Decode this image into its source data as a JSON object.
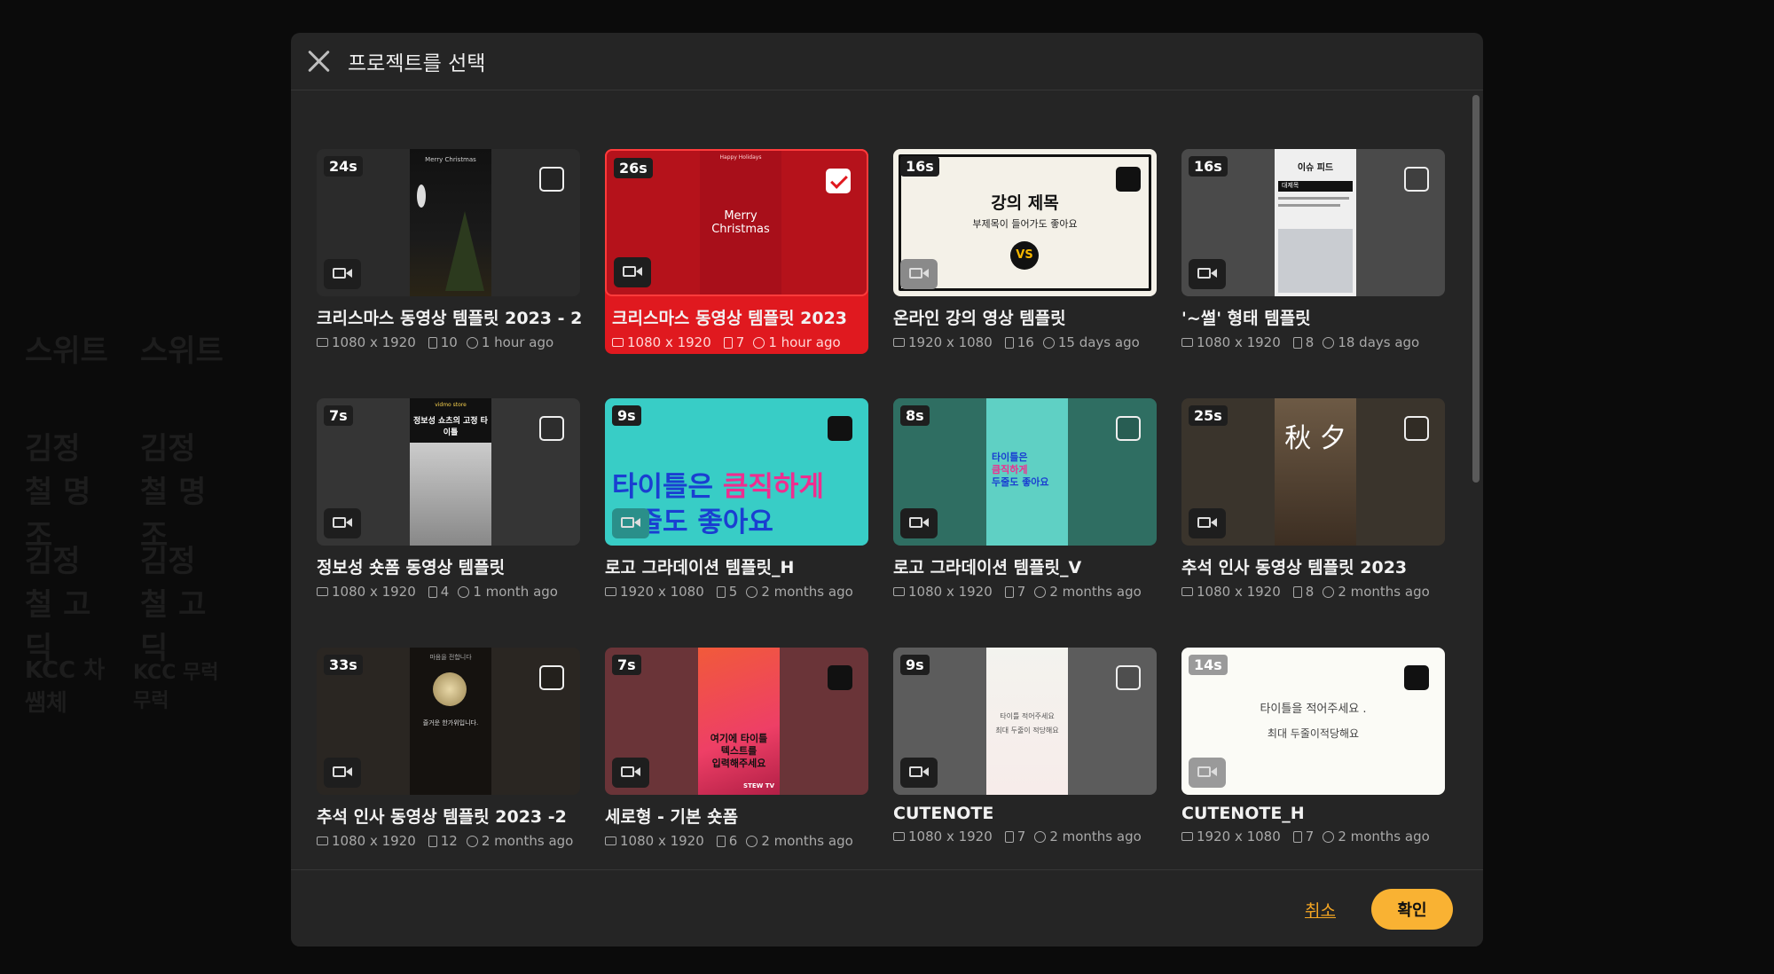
{
  "modal": {
    "title": "프로젝트를 선택",
    "cancel_label": "취소",
    "confirm_label": "확인"
  },
  "background": {
    "words": [
      "스위트",
      "스위트",
      "김정철 명조",
      "김정철 명조",
      "김정철 고딕",
      "김정철 고딕",
      "KCC 차쌤체",
      "KCC 무럭무럭"
    ]
  },
  "thumb_texts": {
    "merry_christmas_small": "Merry Christmas",
    "happy_holidays": "Happy Holidays",
    "merry_christmas": "Merry Christmas",
    "lecture_title": "강의 제목",
    "lecture_subtitle": "부제목이 들어가도 좋아요",
    "lecture_logo": "VS",
    "issue_feed": "이슈 피드",
    "issue_tag": "대제목",
    "shorts_badge": "vidmo store",
    "shorts_title": "정보성 쇼츠의 고정 타이틀",
    "title_big_line1a": "타이틀은 ",
    "title_big_line1b": "큼직하게",
    "title_big_line2": "두줄도 좋아요",
    "title_v_line1": "타이틀은",
    "title_v_line2": "큼직하게",
    "title_v_line3": "두줄도 좋아요",
    "chuseok": "秋 夕",
    "moon_text": "마음을 전합니다",
    "moon_sub": "즐거운 한가위입니다.",
    "vertical_line1": "여기에 타이틀",
    "vertical_line2": "텍스트를",
    "vertical_line3": "입력해주세요",
    "stew": "STEW TV",
    "note_line1": "타이틀 적어주세요",
    "note_line2": "최대 두줄이 적당해요",
    "noteh_line1": "타이틀을 적어주세요 .",
    "noteh_line2": "최대 두줄이적당해요"
  },
  "cards": [
    {
      "name": "크리스마스 동영상 템플릿 2023 - 2",
      "duration": "24s",
      "size": "1080 x 1920",
      "pages": "10",
      "updated": "1 hour ago",
      "selected": false
    },
    {
      "name": "크리스마스 동영상 템플릿 2023",
      "duration": "26s",
      "size": "1080 x 1920",
      "pages": "7",
      "updated": "1 hour ago",
      "selected": true
    },
    {
      "name": "온라인 강의 영상 템플릿",
      "duration": "16s",
      "size": "1920 x 1080",
      "pages": "16",
      "updated": "15 days ago",
      "selected": false
    },
    {
      "name": "'~썰' 형태 템플릿",
      "duration": "16s",
      "size": "1080 x 1920",
      "pages": "8",
      "updated": "18 days ago",
      "selected": false
    },
    {
      "name": "정보성 숏폼 동영상 템플릿",
      "duration": "7s",
      "size": "1080 x 1920",
      "pages": "4",
      "updated": "1 month ago",
      "selected": false
    },
    {
      "name": "로고 그라데이션 템플릿_H",
      "duration": "9s",
      "size": "1920 x 1080",
      "pages": "5",
      "updated": "2 months ago",
      "selected": false
    },
    {
      "name": "로고 그라데이션 템플릿_V",
      "duration": "8s",
      "size": "1080 x 1920",
      "pages": "7",
      "updated": "2 months ago",
      "selected": false
    },
    {
      "name": "추석 인사 동영상 템플릿 2023",
      "duration": "25s",
      "size": "1080 x 1920",
      "pages": "8",
      "updated": "2 months ago",
      "selected": false
    },
    {
      "name": "추석 인사 동영상 템플릿 2023 -2",
      "duration": "33s",
      "size": "1080 x 1920",
      "pages": "12",
      "updated": "2 months ago",
      "selected": false
    },
    {
      "name": "세로형 - 기본 숏폼",
      "duration": "7s",
      "size": "1080 x 1920",
      "pages": "6",
      "updated": "2 months ago",
      "selected": false
    },
    {
      "name": "CUTENOTE",
      "duration": "9s",
      "size": "1080 x 1920",
      "pages": "7",
      "updated": "2 months ago",
      "selected": false
    },
    {
      "name": "CUTENOTE_H",
      "duration": "14s",
      "size": "1920 x 1080",
      "pages": "7",
      "updated": "2 months ago",
      "selected": false
    }
  ]
}
